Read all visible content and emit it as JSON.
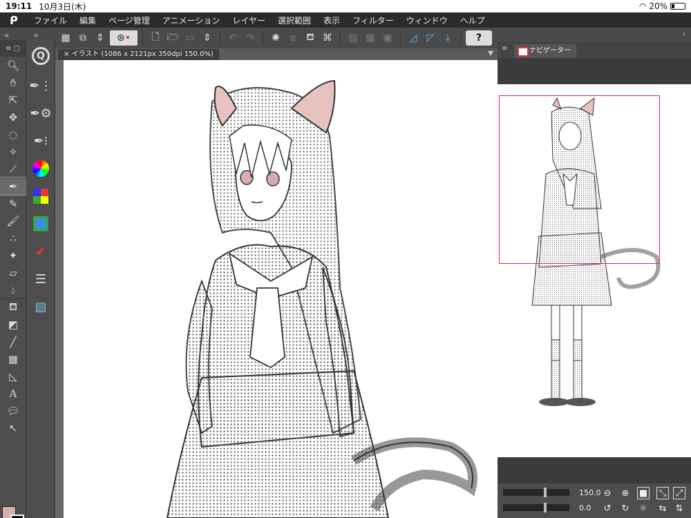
{
  "status": {
    "time": "19:11",
    "date": "10月3日(木)",
    "battery": "20%"
  },
  "menu": {
    "items": [
      "ファイル",
      "編集",
      "ページ管理",
      "アニメーション",
      "レイヤー",
      "選択範囲",
      "表示",
      "フィルター",
      "ウィンドウ",
      "ヘルプ"
    ]
  },
  "canvas": {
    "tab_title": "イラスト (1086 x 2121px 350dpi 150.0%)"
  },
  "navigator": {
    "tab_title": "ナビゲーター",
    "zoom": "150.0",
    "rotation": "0.0"
  },
  "colors": {
    "main": "#d6aeb0",
    "sub": "#111111"
  }
}
